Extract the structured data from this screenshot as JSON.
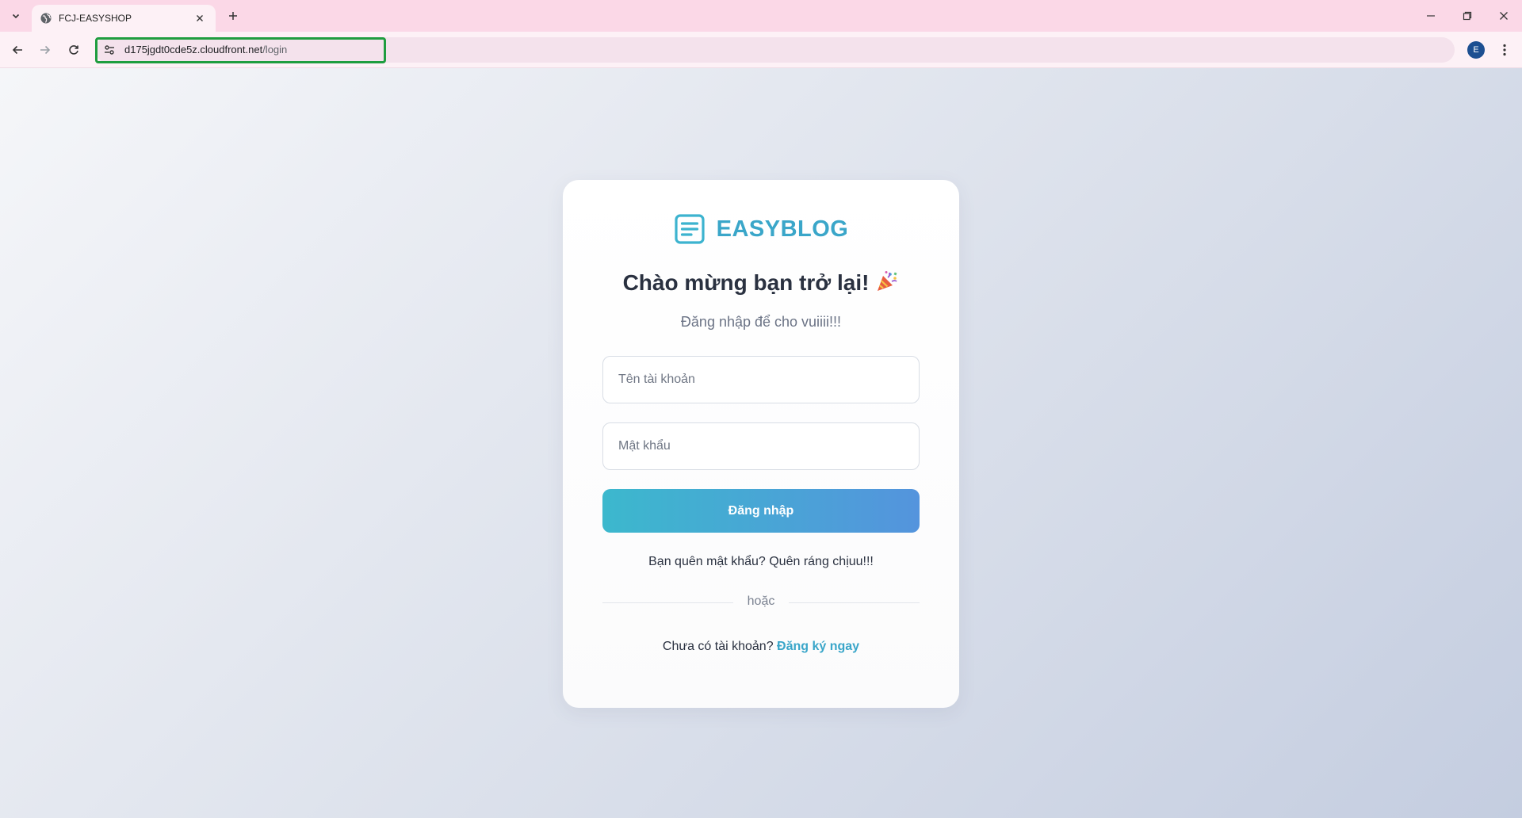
{
  "browser": {
    "tab_title": "FCJ-EASYSHOP",
    "url_host": "d175jgdt0cde5z.cloudfront.net",
    "url_path": "/login",
    "profile_initial": "E",
    "omnibox_highlight_color": "#1f9d3f"
  },
  "page": {
    "brand": "EASYBLOG",
    "welcome_title": "Chào mừng bạn trở lại!",
    "welcome_emoji": "party-popper-icon",
    "subtitle": "Đăng nhập để cho vuiiii!!!",
    "username_placeholder": "Tên tài khoản",
    "password_placeholder": "Mật khẩu",
    "username_value": "",
    "password_value": "",
    "login_button": "Đăng nhập",
    "forgot_text": "Bạn quên mật khẩu? Quên ráng chịuu!!!",
    "or_text": "hoặc",
    "signup_prompt": "Chưa có tài khoản?",
    "signup_link": "Đăng ký ngay"
  },
  "colors": {
    "brand": "#3aa6c9",
    "button_gradient_start": "#3cb8cd",
    "button_gradient_end": "#5494dd",
    "tabbar": "#fbd8e7"
  }
}
